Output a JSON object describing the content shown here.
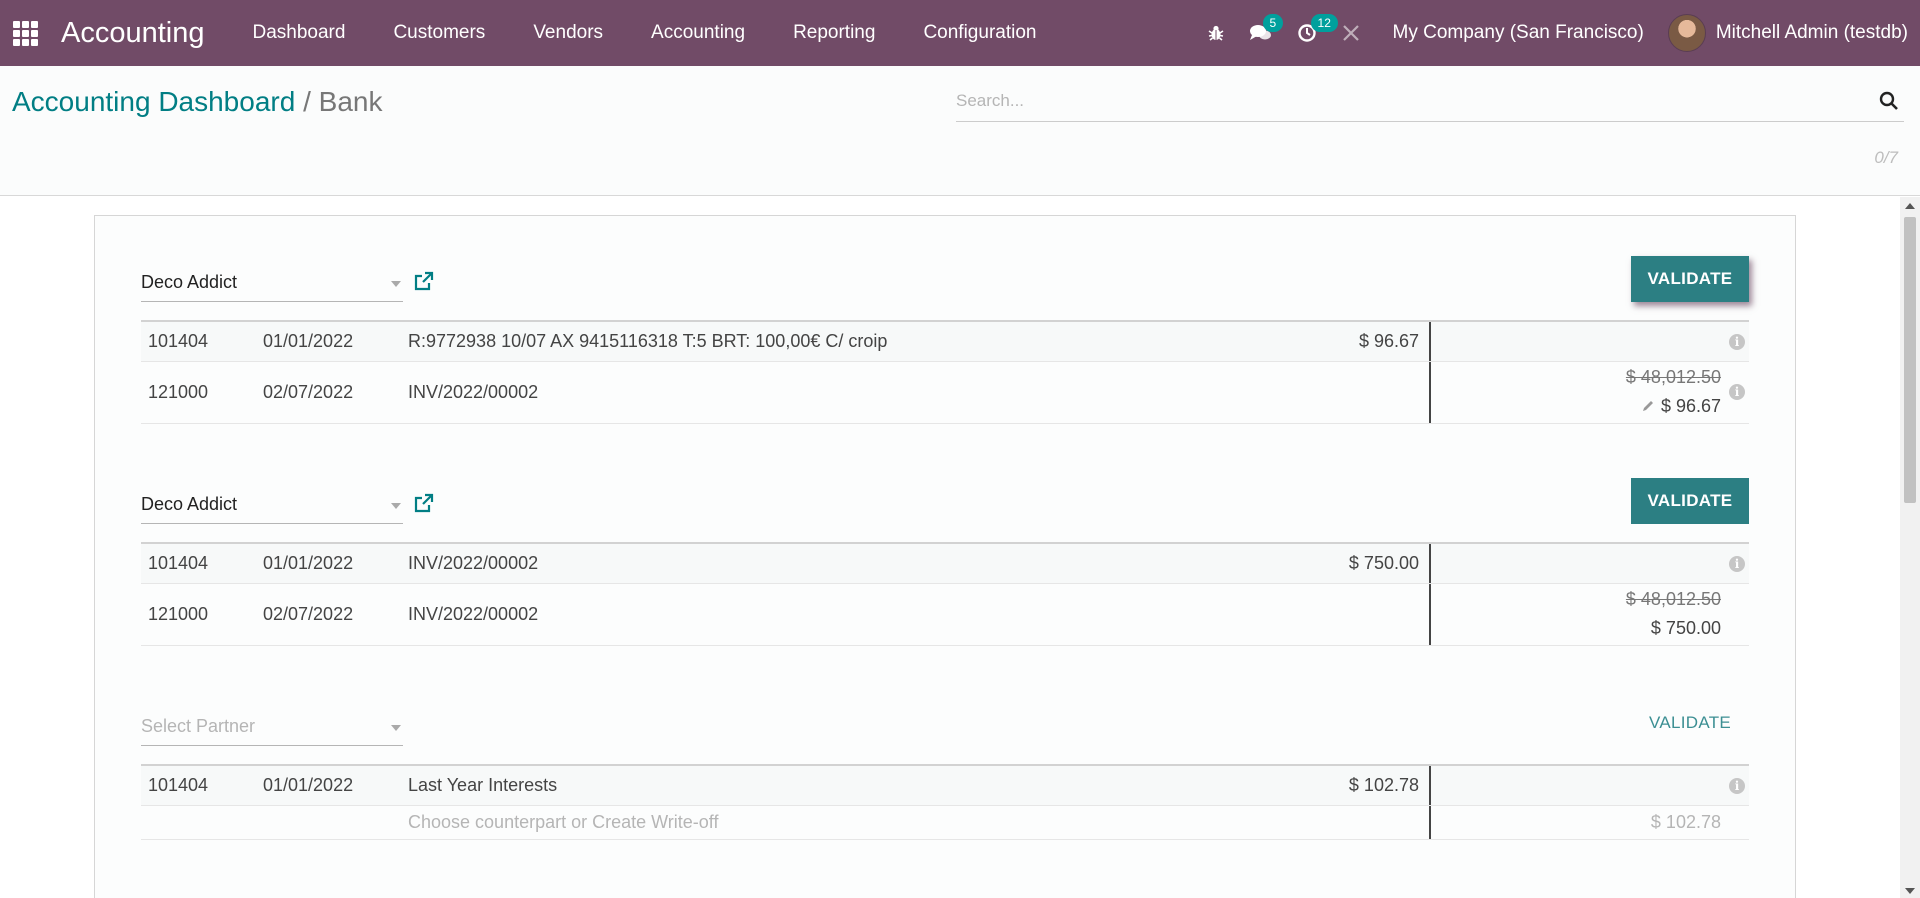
{
  "navbar": {
    "brand": "Accounting",
    "menu": [
      "Dashboard",
      "Customers",
      "Vendors",
      "Accounting",
      "Reporting",
      "Configuration"
    ],
    "messages_count": "5",
    "activities_count": "12",
    "company": "My Company (San Francisco)",
    "user": "Mitchell Admin (testdb)"
  },
  "control": {
    "breadcrumb_parent": "Accounting Dashboard",
    "breadcrumb_sep": "/",
    "breadcrumb_current": "Bank",
    "search_placeholder": "Search...",
    "pager": "0/7"
  },
  "reconciliations": [
    {
      "partner": "Deco Addict",
      "validate": "VALIDATE",
      "statement_line": {
        "account": "101404",
        "date": "01/01/2022",
        "label": "R:9772938 10/07 AX 9415116318 T:5 BRT: 100,00€ C/ croip",
        "amount": "$ 96.67"
      },
      "matched_line": {
        "account": "121000",
        "date": "02/07/2022",
        "label": "INV/2022/00002",
        "original": "$ 48,012.50",
        "amount": "$ 96.67"
      }
    },
    {
      "partner": "Deco Addict",
      "validate": "VALIDATE",
      "statement_line": {
        "account": "101404",
        "date": "01/01/2022",
        "label": "INV/2022/00002",
        "amount": "$ 750.00"
      },
      "matched_line": {
        "account": "121000",
        "date": "02/07/2022",
        "label": "INV/2022/00002",
        "original": "$ 48,012.50",
        "amount": "$ 750.00"
      }
    },
    {
      "partner_placeholder": "Select Partner",
      "validate": "VALIDATE",
      "statement_line": {
        "account": "101404",
        "date": "01/01/2022",
        "label": "Last Year Interests",
        "amount": "$ 102.78"
      },
      "counterpart_hint": "Choose counterpart or Create Write-off",
      "open_balance": "$ 102.78"
    }
  ],
  "colors": {
    "navbar": "#714b67",
    "primary": "#017e84",
    "validate_button": "#2c7f83",
    "badge": "#00a09d"
  }
}
